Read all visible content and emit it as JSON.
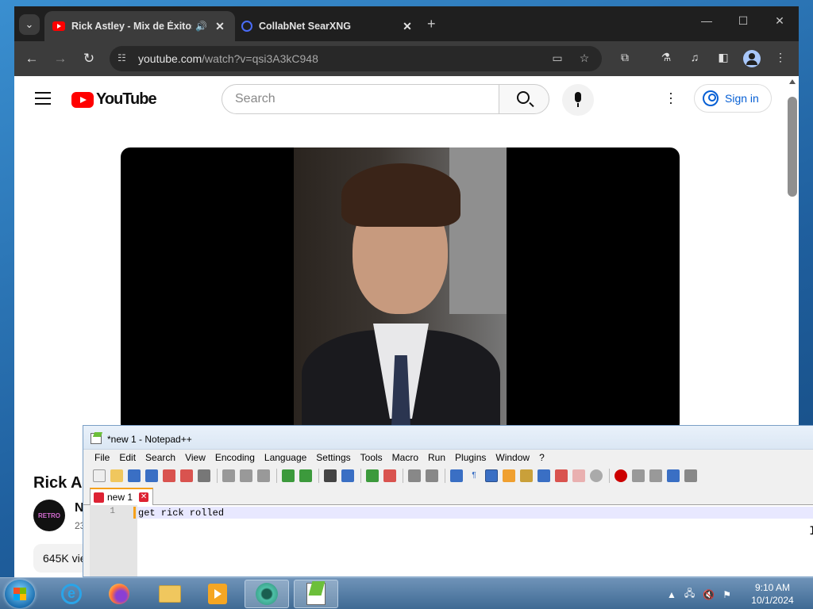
{
  "chrome": {
    "tabs": [
      {
        "title": "Rick Astley - Mix de Éxitos",
        "audio_icon": "speaker-icon"
      },
      {
        "title": "CollabNet SearXNG"
      }
    ],
    "url_domain": "youtube.com",
    "url_path": "/watch?v=qsi3A3kC948"
  },
  "youtube": {
    "logo_text": "YouTube",
    "search_placeholder": "Search",
    "sign_in": "Sign in",
    "video_title": "Rick As",
    "channel_avatar_text": "RETRO",
    "channel_initial": "N",
    "sub_count": "23",
    "views": "645K vie"
  },
  "notepad": {
    "title": "*new 1 - Notepad++",
    "menu": [
      "File",
      "Edit",
      "Search",
      "View",
      "Encoding",
      "Language",
      "Settings",
      "Tools",
      "Macro",
      "Run",
      "Plugins",
      "Window",
      "?"
    ],
    "tab": "new 1",
    "line_number": "1",
    "text": "get rick rolled"
  },
  "taskbar": {
    "time": "9:10 AM",
    "date": "10/1/2024",
    "apps": [
      "internet-explorer",
      "firefox",
      "file-explorer",
      "media-player",
      "chrome",
      "notepad++"
    ]
  },
  "colors": {
    "youtube_red": "#ff0000",
    "chrome_dark": "#1f1f1f",
    "signin_blue": "#065fd4",
    "npp_orange": "#f6a01a"
  }
}
